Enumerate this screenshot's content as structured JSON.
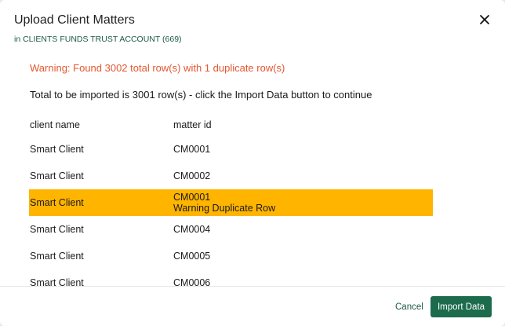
{
  "dialog": {
    "title": "Upload Client Matters",
    "subtitle": "in CLIENTS FUNDS TRUST ACCOUNT (669)",
    "close_icon": "close-icon"
  },
  "messages": {
    "warning": "Warning: Found 3002 total row(s) with 1 duplicate row(s)",
    "total": "Total to be imported is 3001 row(s) - click the Import Data button to continue"
  },
  "table": {
    "headers": [
      "client name",
      "matter id"
    ],
    "rows": [
      {
        "client": "Smart Client",
        "matter": "CM0001",
        "note": ""
      },
      {
        "client": "Smart Client",
        "matter": "CM0002",
        "note": ""
      },
      {
        "client": "Smart Client",
        "matter": "CM0001",
        "note": "Warning Duplicate Row"
      },
      {
        "client": "Smart Client",
        "matter": "CM0004",
        "note": ""
      },
      {
        "client": "Smart Client",
        "matter": "CM0005",
        "note": ""
      },
      {
        "client": "Smart Client",
        "matter": "CM0006",
        "note": ""
      }
    ]
  },
  "footer": {
    "cancel_label": "Cancel",
    "import_label": "Import Data"
  },
  "colors": {
    "accent": "#1c6b4c",
    "warning_text": "#e4572e",
    "duplicate_highlight": "#ffb400"
  }
}
